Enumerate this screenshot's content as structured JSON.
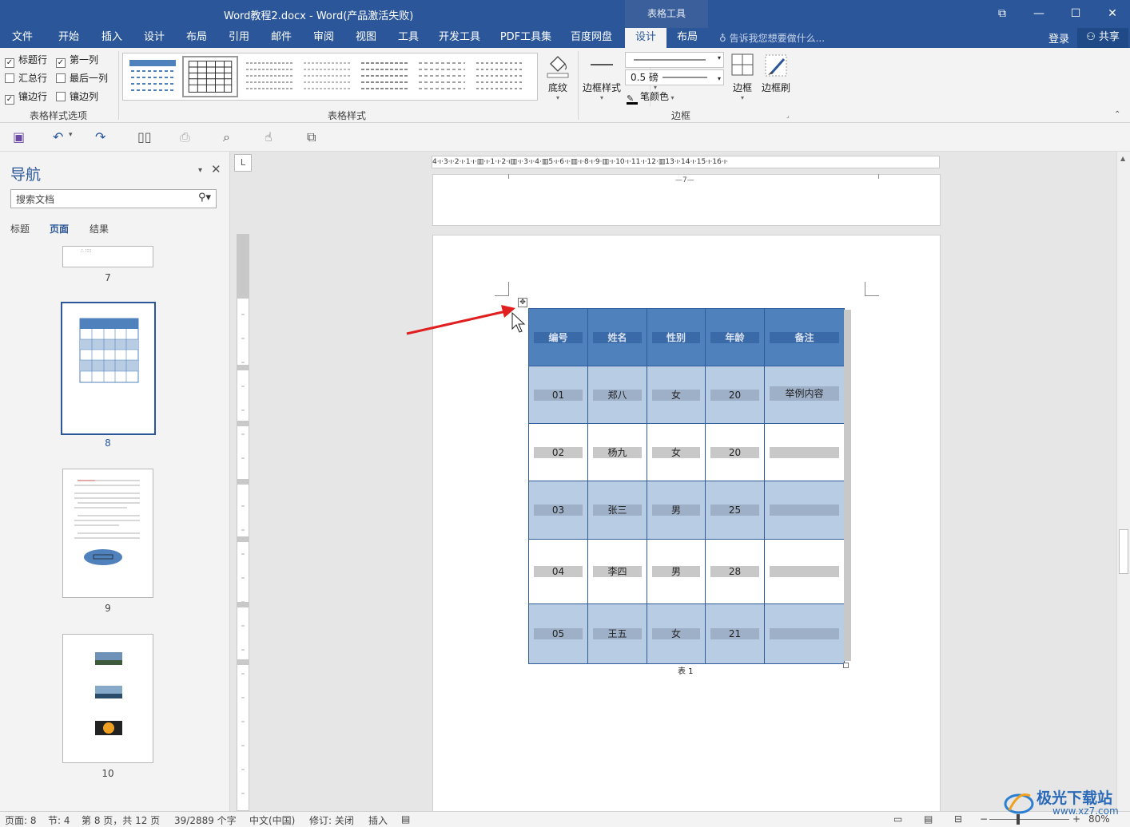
{
  "window": {
    "title": "Word教程2.docx - Word(产品激活失败)",
    "context_tools_label": "表格工具",
    "controls": [
      "⧉",
      "—",
      "☐",
      "✕"
    ]
  },
  "ribbon_tabs": [
    "文件",
    "开始",
    "插入",
    "设计",
    "布局",
    "引用",
    "邮件",
    "审阅",
    "视图",
    "工具",
    "开发工具",
    "PDF工具集",
    "百度网盘",
    "设计",
    "布局"
  ],
  "tell_me": "告诉我您想要做什么...",
  "account": {
    "login": "登录",
    "share": "共享"
  },
  "style_options": {
    "items": [
      {
        "label": "标题行",
        "checked": true
      },
      {
        "label": "第一列",
        "checked": true
      },
      {
        "label": "汇总行",
        "checked": false
      },
      {
        "label": "最后一列",
        "checked": false
      },
      {
        "label": "镶边行",
        "checked": true
      },
      {
        "label": "镶边列",
        "checked": false
      }
    ],
    "group_label": "表格样式选项"
  },
  "table_styles": {
    "group_label": "表格样式",
    "shading_label": "底纹"
  },
  "borders": {
    "border_styles_label": "边框样式",
    "weight_value": "0.5 磅",
    "pen_color_label": "笔颜色",
    "borders_label": "边框",
    "border_painter_label": "边框刷",
    "group_label": "边框"
  },
  "navigation": {
    "title": "导航",
    "search_placeholder": "搜索文档",
    "tabs": [
      "标题",
      "页面",
      "结果"
    ],
    "pages": [
      "7",
      "8",
      "9",
      "10"
    ]
  },
  "ruler": {
    "horizontal": "4·ı·3·ı·2·ı·1·ı·▥·ı·1·ı·2·ı▥·ı·3·ı·4·▥5·ı·6·ı·▥·ı·8·ı·9·▥·ı·10·ı·11·ı·12·▥13·ı·14·ı·15·ı·16·ı·",
    "corner": "L"
  },
  "page7_footer": "—7—",
  "table": {
    "headers": [
      "编号",
      "姓名",
      "性别",
      "年龄",
      "备注"
    ],
    "rows": [
      [
        "01",
        "郑八",
        "女",
        "20",
        "举例内容"
      ],
      [
        "02",
        "杨九",
        "女",
        "20",
        ""
      ],
      [
        "03",
        "张三",
        "男",
        "25",
        ""
      ],
      [
        "04",
        "李四",
        "男",
        "28",
        ""
      ],
      [
        "05",
        "王五",
        "女",
        "21",
        ""
      ]
    ],
    "caption": "表 1"
  },
  "status": {
    "page": "页面: 8",
    "section": "节: 4",
    "page_of": "第 8 页，共 12 页",
    "words": "39/2889 个字",
    "language": "中文(中国)",
    "track": "修订: 关闭",
    "insert": "插入",
    "zoom": "80%"
  },
  "watermark": {
    "brand": "极光下载站",
    "url": "www.xz7.com"
  },
  "colors": {
    "accent": "#2b579a",
    "header_fill": "#4f81bd",
    "band_fill": "#b8cce4",
    "arrow": "#e02020"
  }
}
